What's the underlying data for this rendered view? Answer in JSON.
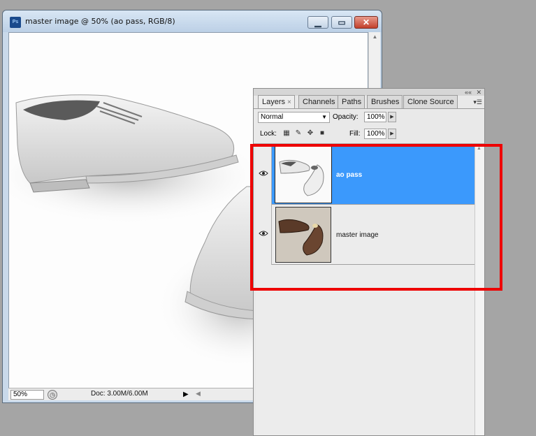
{
  "document": {
    "title": "master image @ 50% (ao pass, RGB/8)",
    "app_icon": "Ps",
    "controls": {
      "minimize": "minimize-icon",
      "maximize": "maximize-icon",
      "close": "close-icon"
    },
    "status": {
      "zoom": "50%",
      "doc_info": "Doc: 3.00M/6.00M"
    }
  },
  "layers_panel": {
    "tabs": [
      {
        "label": "Layers",
        "active": true,
        "close": "×"
      },
      {
        "label": "Channels"
      },
      {
        "label": "Paths"
      },
      {
        "label": "Brushes"
      },
      {
        "label": "Clone Source"
      }
    ],
    "blend_mode": "Normal",
    "opacity_label": "Opacity:",
    "opacity_value": "100%",
    "lock_label": "Lock:",
    "lock_icons": [
      "lock-transparency-icon",
      "lock-pixels-icon",
      "lock-position-icon",
      "lock-all-icon"
    ],
    "fill_label": "Fill:",
    "fill_value": "100%",
    "layers": [
      {
        "name": "ao pass",
        "selected": true,
        "visible": true
      },
      {
        "name": "master image",
        "selected": false,
        "visible": true
      }
    ]
  },
  "annotation": {
    "color": "#ee0000"
  },
  "colors": {
    "selected_layer": "#3b99fc",
    "panel_bg": "#e9e9e9",
    "workspace": "#a5a5a5"
  }
}
